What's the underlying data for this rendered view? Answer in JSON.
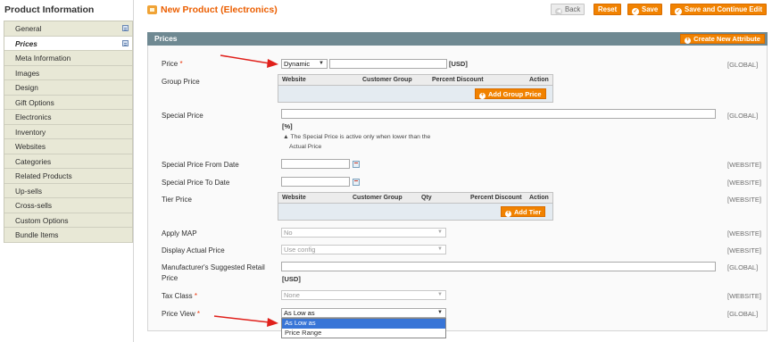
{
  "sidebar": {
    "title": "Product Information",
    "items": [
      {
        "label": "General"
      },
      {
        "label": "Prices"
      },
      {
        "label": "Meta Information"
      },
      {
        "label": "Images"
      },
      {
        "label": "Design"
      },
      {
        "label": "Gift Options"
      },
      {
        "label": "Electronics"
      },
      {
        "label": "Inventory"
      },
      {
        "label": "Websites"
      },
      {
        "label": "Categories"
      },
      {
        "label": "Related Products"
      },
      {
        "label": "Up-sells"
      },
      {
        "label": "Cross-sells"
      },
      {
        "label": "Custom Options"
      },
      {
        "label": "Bundle Items"
      }
    ]
  },
  "header": {
    "title": "New Product (Electronics)",
    "back": "Back",
    "reset": "Reset",
    "save": "Save",
    "save_continue": "Save and Continue Edit"
  },
  "section": {
    "title": "Prices",
    "create_attribute": "Create New Attribute"
  },
  "fields": {
    "price": {
      "label": "Price",
      "required": "*",
      "select": "Dynamic",
      "unit": "[USD]",
      "scope": "[GLOBAL]"
    },
    "group_price": {
      "label": "Group Price",
      "cols": [
        "Website",
        "Customer Group",
        "Percent Discount",
        "Action"
      ],
      "add": "Add Group Price"
    },
    "special_price": {
      "label": "Special Price",
      "unit": "[%]",
      "note1": "The Special Price is active only when lower than the",
      "note2": "Actual Price",
      "scope": "[GLOBAL]"
    },
    "special_from": {
      "label": "Special Price From Date",
      "scope": "[WEBSITE]"
    },
    "special_to": {
      "label": "Special Price To Date",
      "scope": "[WEBSITE]"
    },
    "tier_price": {
      "label": "Tier Price",
      "cols": [
        "Website",
        "Customer Group",
        "Qty",
        "Percent Discount",
        "Action"
      ],
      "add": "Add Tier",
      "scope": "[WEBSITE]"
    },
    "apply_map": {
      "label": "Apply MAP",
      "value": "No",
      "scope": "[WEBSITE]"
    },
    "display_actual": {
      "label": "Display Actual Price",
      "value": "Use config",
      "scope": "[WEBSITE]"
    },
    "msrp": {
      "label1": "Manufacturer's Suggested Retail",
      "label2": "Price",
      "unit": "[USD]",
      "scope": "[GLOBAL]"
    },
    "tax_class": {
      "label": "Tax Class",
      "required": "*",
      "value": "None",
      "scope": "[WEBSITE]"
    },
    "price_view": {
      "label": "Price View",
      "required": "*",
      "value": "As Low as",
      "options": [
        "As Low as",
        "Price Range"
      ],
      "scope": "[GLOBAL]"
    }
  },
  "colors": {
    "accent": "#f18200",
    "title": "#eb5e00",
    "section_header": "#6f8992",
    "annotation_arrow": "#e0201b"
  }
}
